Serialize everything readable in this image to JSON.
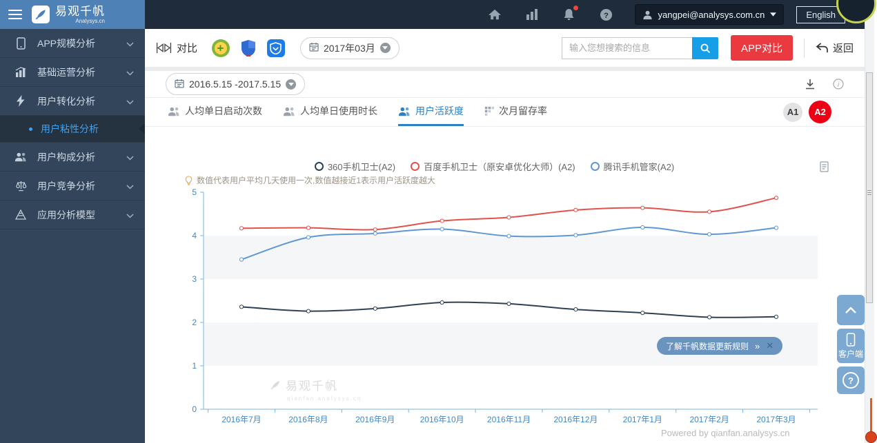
{
  "topbar": {
    "brand": {
      "title": "易观千帆",
      "subtitle": "Analysys.cn"
    },
    "user_email": "yangpei@analysys.com.cn",
    "language_label": "English"
  },
  "sidebar": {
    "items": [
      {
        "label": "APP规模分析",
        "icon": "phone"
      },
      {
        "label": "基础运营分析",
        "icon": "chart"
      },
      {
        "label": "用户转化分析",
        "icon": "bolt",
        "children": [
          {
            "label": "用户粘性分析",
            "active": true
          }
        ]
      },
      {
        "label": "用户构成分析",
        "icon": "users"
      },
      {
        "label": "用户竞争分析",
        "icon": "scale"
      },
      {
        "label": "应用分析模型",
        "icon": "model"
      }
    ]
  },
  "toolbar": {
    "compare_label": "对比",
    "apps": [
      {
        "name": "360手机卫士",
        "style": "s360"
      },
      {
        "name": "百度手机卫士",
        "style": "baidu"
      },
      {
        "name": "腾讯手机管家",
        "style": "tencent"
      }
    ],
    "month_label": "2017年03月",
    "search_placeholder": "输入您想搜索的信息",
    "app_compare_label": "APP对比",
    "back_label": "返回"
  },
  "panel": {
    "date_range_label": "2016.5.15 -2017.5.15",
    "tabs": [
      {
        "label": "人均单日启动次数",
        "icon": "users",
        "active": false
      },
      {
        "label": "人均单日使用时长",
        "icon": "users",
        "active": false
      },
      {
        "label": "用户活跃度",
        "icon": "users",
        "active": true
      },
      {
        "label": "次月留存率",
        "icon": "grid",
        "active": false
      }
    ],
    "badges": [
      {
        "label": "A1",
        "active": false
      },
      {
        "label": "A2",
        "active": true
      }
    ],
    "hint": "数值代表用户平均几天使用一次,数值越接近1表示用户活跃度越大",
    "tooltip": {
      "text": "了解千帆数据更新规则",
      "more_symbol": "»",
      "close_symbol": "✕"
    },
    "watermark": {
      "title": "易观千帆",
      "subtitle": "qianfan.analysys.cn"
    },
    "powered_by": "Powered by qianfan.analysys.cn"
  },
  "floating": {
    "client_label": "客户端"
  },
  "chart_data": {
    "type": "line",
    "title": "用户活跃度",
    "categories": [
      "2016年7月",
      "2016年8月",
      "2016年9月",
      "2016年10月",
      "2016年11月",
      "2016年12月",
      "2017年1月",
      "2017年2月",
      "2017年3月"
    ],
    "series": [
      {
        "name": "360手机卫士(A2)",
        "color": "#2e4154",
        "values": [
          2.36,
          2.26,
          2.32,
          2.46,
          2.43,
          2.3,
          2.22,
          2.12,
          2.13
        ]
      },
      {
        "name": "百度手机卫士（原安卓优化大师）(A2)",
        "color": "#e2514b",
        "values": [
          4.17,
          4.18,
          4.14,
          4.34,
          4.42,
          4.59,
          4.64,
          4.55,
          4.87
        ]
      },
      {
        "name": "腾讯手机管家(A2)",
        "color": "#5e97d2",
        "values": [
          3.45,
          3.96,
          4.05,
          4.15,
          3.99,
          4.01,
          4.19,
          4.03,
          4.18
        ]
      }
    ],
    "ylim": [
      0,
      5
    ],
    "yticks": [
      0,
      1,
      2,
      3,
      4,
      5
    ],
    "grid": "alternating-horizontal-stripes",
    "stripe_color": "#f4f6f8",
    "axis_color": "#7ab5dd",
    "tick_label_color": "#3d88c8",
    "legend_position": "top-center"
  }
}
